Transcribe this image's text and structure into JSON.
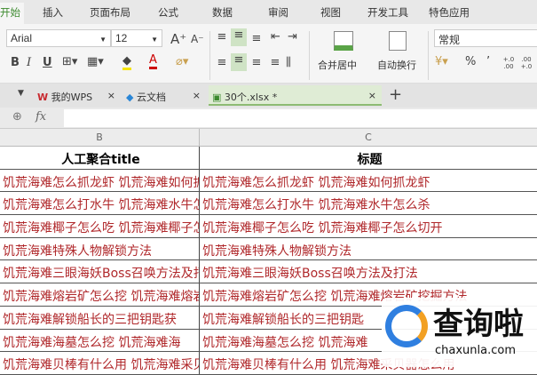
{
  "menu": [
    "开始",
    "插入",
    "页面布局",
    "公式",
    "数据",
    "审阅",
    "视图",
    "开发工具",
    "特色应用"
  ],
  "ribbon": {
    "font": "Arial",
    "size": "12",
    "merge": "合并居中",
    "wrap": "自动换行",
    "format": "常规",
    "percent": "%",
    "comma": "’",
    "inc_dec": "+.0 .00",
    "dec_dec": ".00 +.0"
  },
  "doc_tabs": [
    {
      "label": "我的WPS"
    },
    {
      "label": "云文档"
    },
    {
      "label": "30个.xlsx *"
    }
  ],
  "formula": {
    "fx": "fx",
    "value": ""
  },
  "columns": [
    "B",
    "C"
  ],
  "header": {
    "b": "人工聚合title",
    "c": "标题"
  },
  "rows": [
    {
      "b": "饥荒海难怎么抓龙虾 饥荒海难如何抓龙虾",
      "c": "饥荒海难怎么抓龙虾 饥荒海难如何抓龙虾"
    },
    {
      "b": "饥荒海难怎么打水牛 饥荒海难水牛怎么杀",
      "c": "饥荒海难怎么打水牛 饥荒海难水牛怎么杀"
    },
    {
      "b": "饥荒海难椰子怎么吃 饥荒海难椰子怎么切开",
      "c": "饥荒海难椰子怎么吃 饥荒海难椰子怎么切开"
    },
    {
      "b": "饥荒海难特殊人物解锁方法",
      "c": "饥荒海难特殊人物解锁方法"
    },
    {
      "b": "饥荒海难三眼海妖Boss召唤方法及打法",
      "c": "饥荒海难三眼海妖Boss召唤方法及打法"
    },
    {
      "b": "饥荒海难熔岩矿怎么挖 饥荒海难熔岩矿挖掘方法",
      "c": "饥荒海难熔岩矿怎么挖 饥荒海难熔岩矿挖掘方法"
    },
    {
      "b": "饥荒海难解锁船长的三把钥匙获",
      "c": "饥荒海难解锁船长的三把钥匙"
    },
    {
      "b": "饥荒海难海墓怎么挖 饥荒海难海",
      "c": "饥荒海难海墓怎么挖 饥荒海难"
    },
    {
      "b": "饥荒海难贝棒有什么用 饥荒海难采贝器怎么用",
      "c": "饥荒海难贝棒有什么用 饥荒海难采贝器怎么用"
    }
  ],
  "watermark": {
    "brand": "查询啦",
    "domain": "chaxunla.com"
  },
  "colors": {
    "accent": "#3c8a2e",
    "cell_text": "#b0282b"
  }
}
